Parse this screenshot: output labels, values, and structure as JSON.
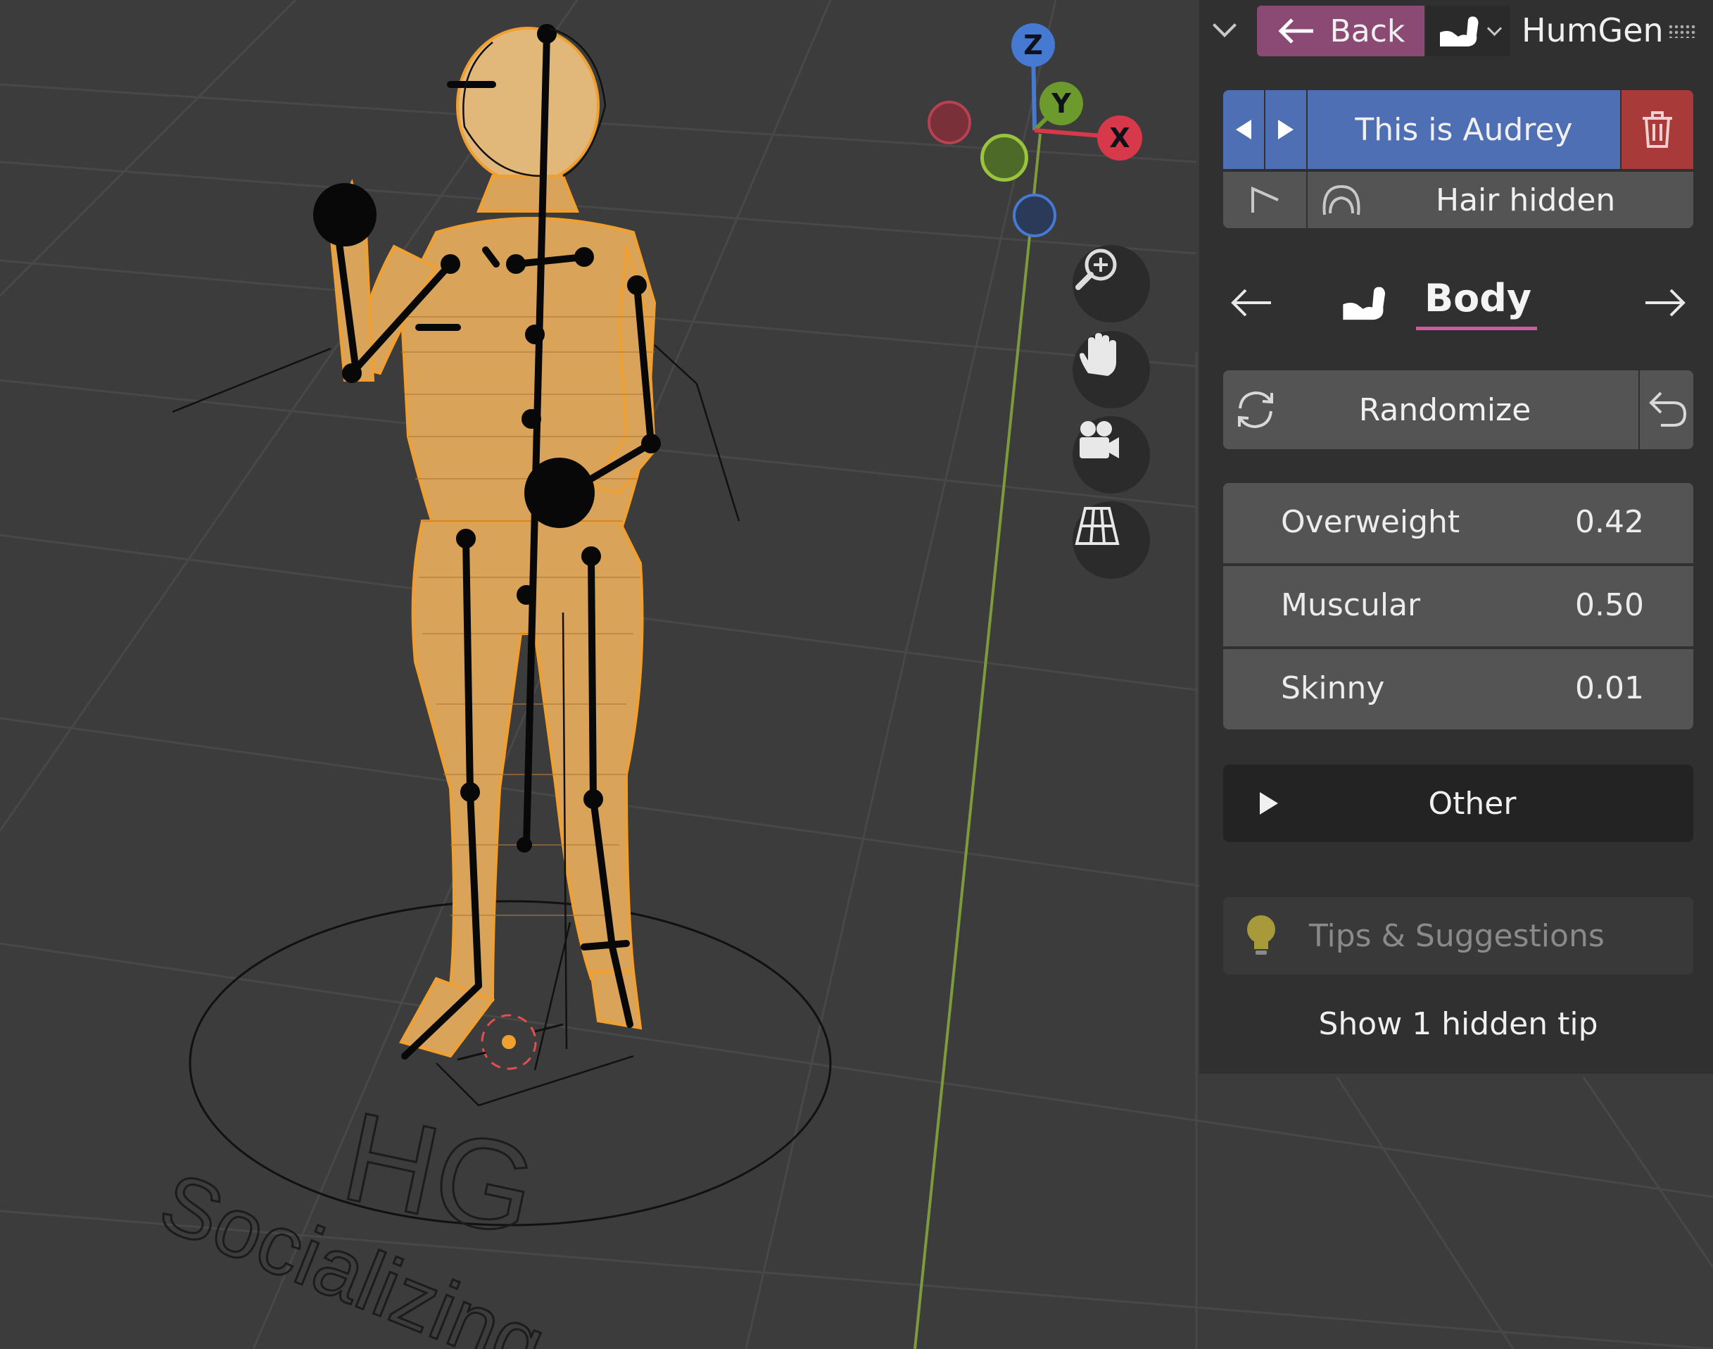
{
  "panel": {
    "back_label": "Back",
    "addon_title": "HumGen",
    "human_name": "This is Audrey",
    "hair_status": "Hair hidden",
    "section_title": "Body",
    "randomize_label": "Randomize",
    "sliders": [
      {
        "label": "Overweight",
        "value": "0.42"
      },
      {
        "label": "Muscular",
        "value": "0.50"
      },
      {
        "label": "Skinny",
        "value": "0.01"
      }
    ],
    "other_label": "Other",
    "tips_label": "Tips & Suggestions",
    "hidden_tips": "Show 1 hidden tip"
  },
  "gizmo": {
    "x_label": "X",
    "y_label": "Y",
    "z_label": "Z"
  },
  "viewport": {
    "floor_logo": "HG",
    "floor_text": "Socializing"
  },
  "icons": {
    "collapse": "chevron-down-icon",
    "back": "arrow-left-icon",
    "body": "flexed-arm-icon",
    "prev": "triangle-left-icon",
    "next": "triangle-right-icon",
    "delete": "trash-icon",
    "pointer": "cursor-icon",
    "hair": "hair-icon",
    "randomize": "refresh-icon",
    "undo": "undo-icon",
    "expand": "triangle-right-icon",
    "tip": "lightbulb-icon",
    "zoom": "zoom-in-icon",
    "pan": "hand-icon",
    "camera": "camera-icon",
    "grid": "perspective-grid-icon"
  },
  "colors": {
    "back_button": "#8a4a73",
    "name_selector": "#4f6fb4",
    "delete_button": "#a83a3a",
    "axis_x": "#d7384a",
    "axis_y": "#6c9a2c",
    "axis_z": "#4679d1",
    "selection": "#f0a030",
    "section_underline": "#d05aa0"
  }
}
